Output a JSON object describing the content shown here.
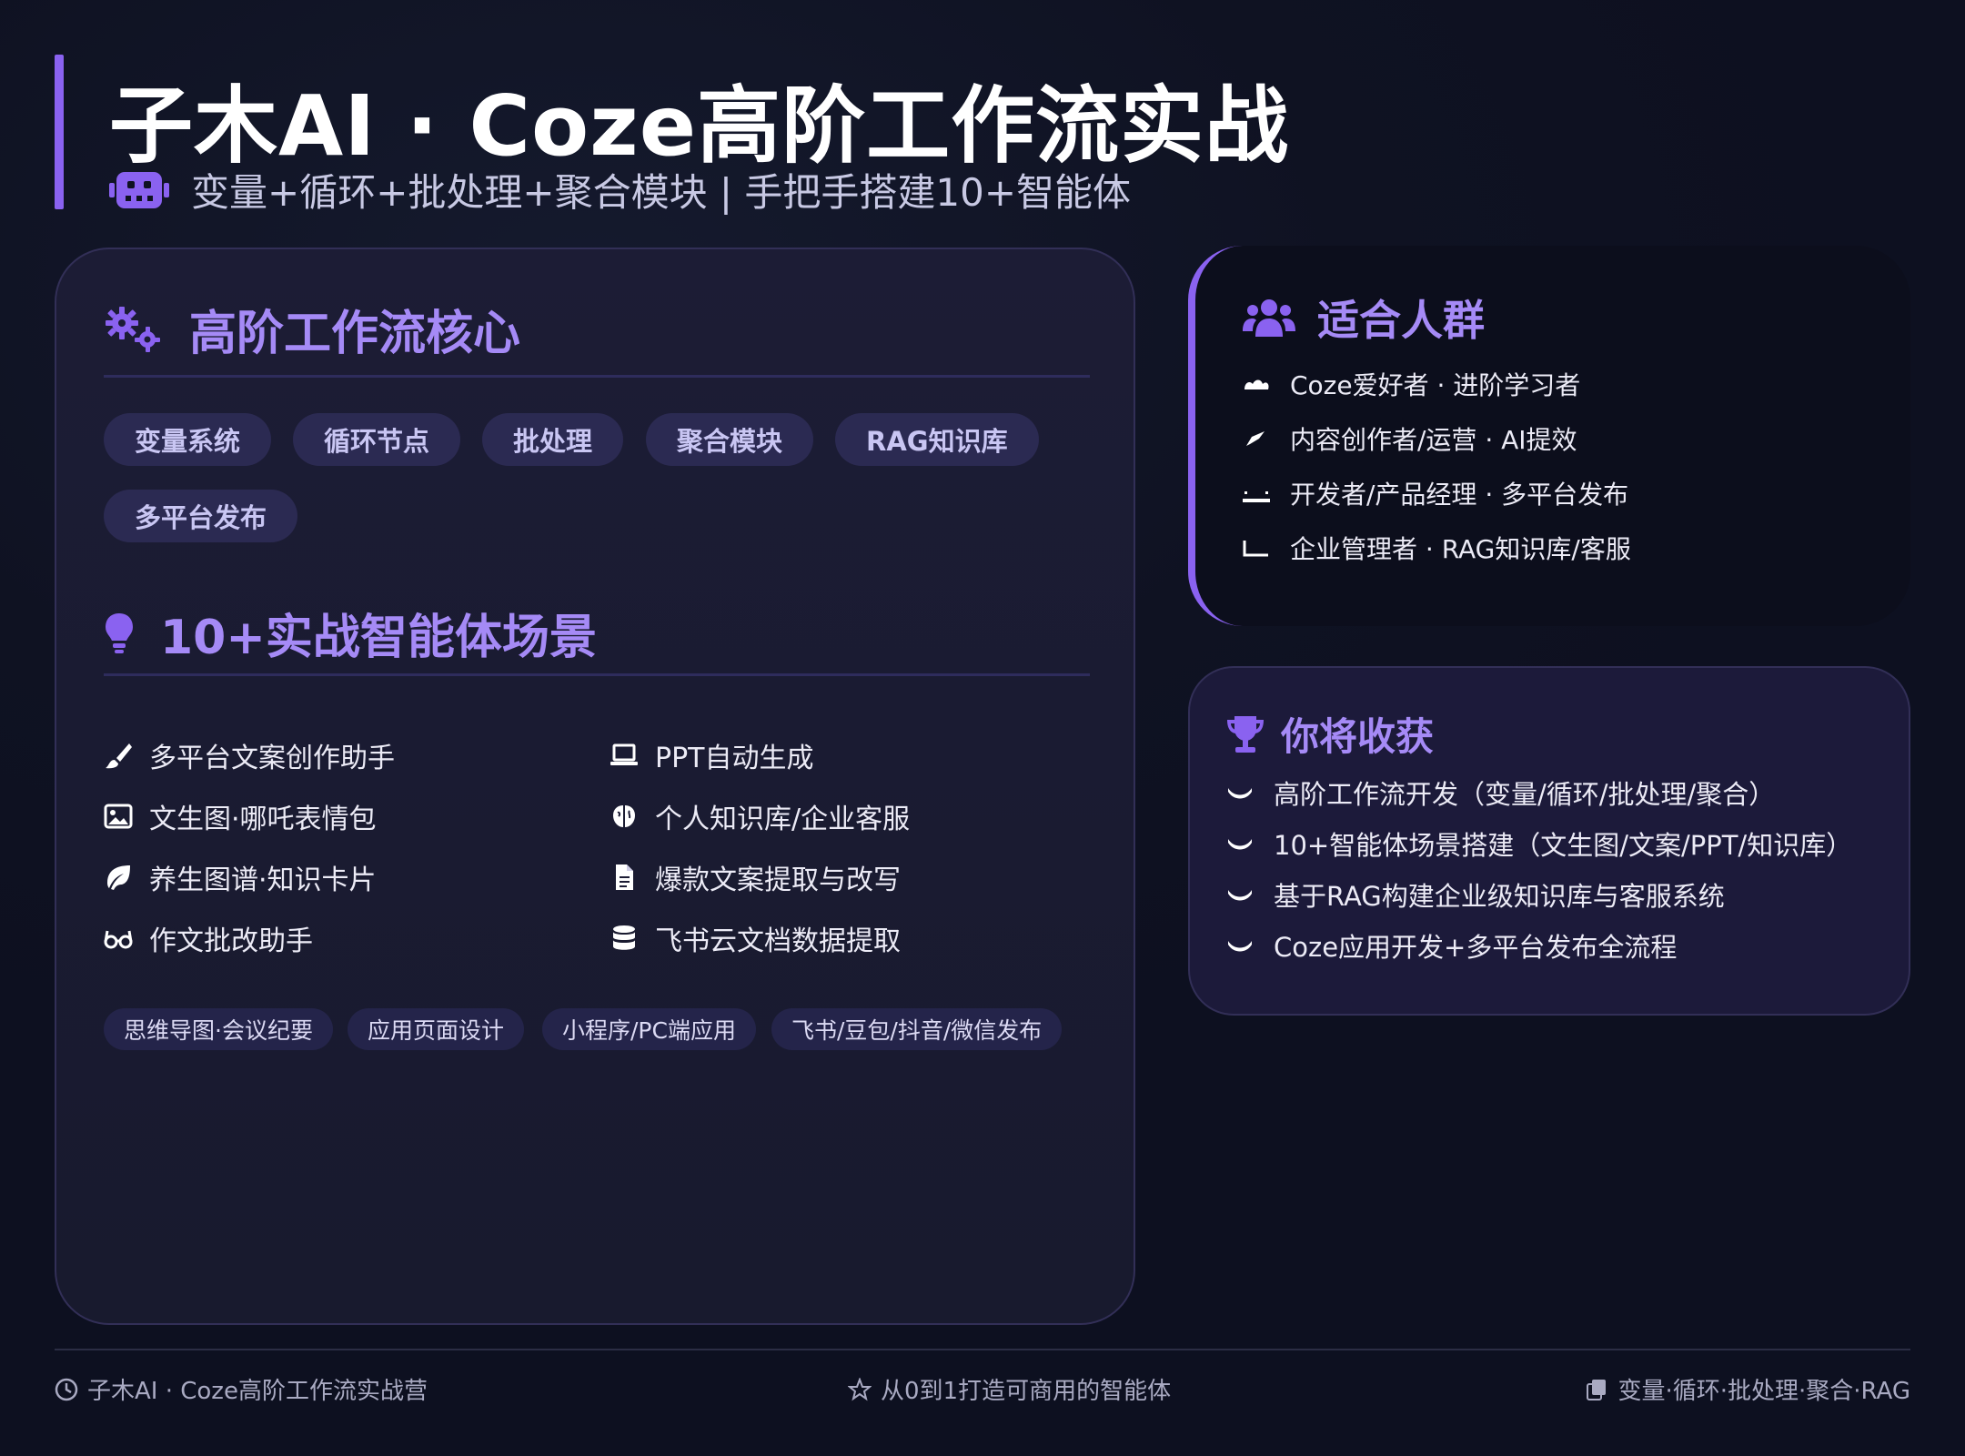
{
  "header": {
    "title": "子木AI · Coze高阶工作流实战",
    "subtitle": "变量+循环+批处理+聚合模块 | 手把手搭建10+智能体",
    "icon": "robot-icon",
    "accent_color": "#8a62f0"
  },
  "core": {
    "heading": "高阶工作流核心",
    "icon": "gears-icon",
    "pills": [
      "变量系统",
      "循环节点",
      "批处理",
      "聚合模块",
      "RAG知识库",
      "多平台发布"
    ]
  },
  "scenarios": {
    "heading": "10+实战智能体场景",
    "icon": "lightbulb-icon",
    "items": [
      {
        "label": "多平台文案创作助手",
        "icon": "brush-icon"
      },
      {
        "label": "PPT自动生成",
        "icon": "laptop-icon"
      },
      {
        "label": "文生图·哪吒表情包",
        "icon": "image-icon"
      },
      {
        "label": "个人知识库/企业客服",
        "icon": "brain-icon"
      },
      {
        "label": "养生图谱·知识卡片",
        "icon": "leaf-icon"
      },
      {
        "label": "爆款文案提取与改写",
        "icon": "file-icon"
      },
      {
        "label": "作文批改助手",
        "icon": "glasses-icon"
      },
      {
        "label": "飞书云文档数据提取",
        "icon": "database-icon"
      }
    ],
    "tags": [
      "思维导图·会议纪要",
      "应用页面设计",
      "小程序/PC端应用",
      "飞书/豆包/抖音/微信发布"
    ]
  },
  "audience": {
    "heading": "适合人群",
    "icon": "users-icon",
    "items": [
      "Coze爱好者 · 进阶学习者",
      "内容创作者/运营 · AI提效",
      "开发者/产品经理 · 多平台发布",
      "企业管理者 · RAG知识库/客服"
    ]
  },
  "gains": {
    "heading": "你将收获",
    "icon": "trophy-icon",
    "items": [
      "高阶工作流开发（变量/循环/批处理/聚合）",
      "10+智能体场景搭建（文生图/文案/PPT/知识库）",
      "基于RAG构建企业级知识库与客服系统",
      "Coze应用开发+多平台发布全流程"
    ]
  },
  "footer": {
    "left": "子木AI · Coze高阶工作流实战营",
    "center": "从0到1打造可商用的智能体",
    "right": "变量·循环·批处理·聚合·RAG"
  }
}
